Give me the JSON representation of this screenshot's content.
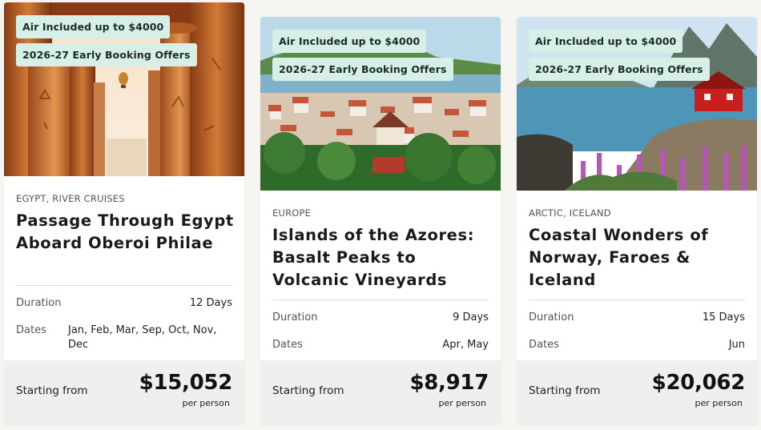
{
  "cards": [
    {
      "badges": [
        "Air Included up to $4000",
        "2026-27 Early Booking Offers"
      ],
      "region": "EGYPT, RIVER CRUISES",
      "title_line1": "Passage Through Egypt",
      "title_line2": "Aboard Oberoi Philae",
      "title_line3": "",
      "duration_label": "Duration",
      "duration": "12 Days",
      "dates_label": "Dates",
      "dates": "Jan, Feb, Mar, Sep, Oct, Nov, Dec",
      "starting_label": "Starting from",
      "price": "$15,052",
      "per_label": "per person"
    },
    {
      "badges": [
        "Air Included up to $4000",
        "2026-27 Early Booking Offers"
      ],
      "region": "EUROPE",
      "title_line1": "Islands of the Azores:",
      "title_line2": "Basalt Peaks to",
      "title_line3": "Volcanic Vineyards",
      "duration_label": "Duration",
      "duration": "9 Days",
      "dates_label": "Dates",
      "dates": "Apr, May",
      "starting_label": "Starting from",
      "price": "$8,917",
      "per_label": "per person"
    },
    {
      "badges": [
        "Air Included up to $4000",
        "2026-27 Early Booking Offers"
      ],
      "region": "ARCTIC, ICELAND",
      "title_line1": "Coastal Wonders of",
      "title_line2": "Norway, Faroes & Iceland",
      "title_line3": "",
      "duration_label": "Duration",
      "duration": "15 Days",
      "dates_label": "Dates",
      "dates": "Jun",
      "starting_label": "Starting from",
      "price": "$20,062",
      "per_label": "per person"
    }
  ]
}
